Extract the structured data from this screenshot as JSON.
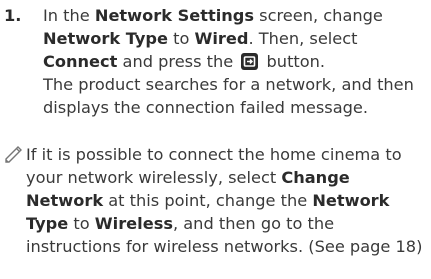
{
  "step": {
    "number": "1.",
    "p1_a": "In the ",
    "p1_b": "Network Settings",
    "p1_c": " screen, change ",
    "p1_d": "Network Type",
    "p1_e": " to ",
    "p1_f": "Wired",
    "p1_g": ". Then, select ",
    "p1_h": "Connect",
    "p1_i": " and press the ",
    "p1_j": " button.",
    "p2": "The product searches for a network, and then displays the connection failed message."
  },
  "note": {
    "icon": "note-pencil-icon",
    "a": "If it is possible to connect the home cinema to your network wirelessly, select ",
    "b": "Change Network",
    "c": " at this point, change the ",
    "d": "Network Type",
    "e": " to ",
    "f": "Wireless",
    "g": ", and then go to the instructions for wireless networks. (See page 18)"
  }
}
